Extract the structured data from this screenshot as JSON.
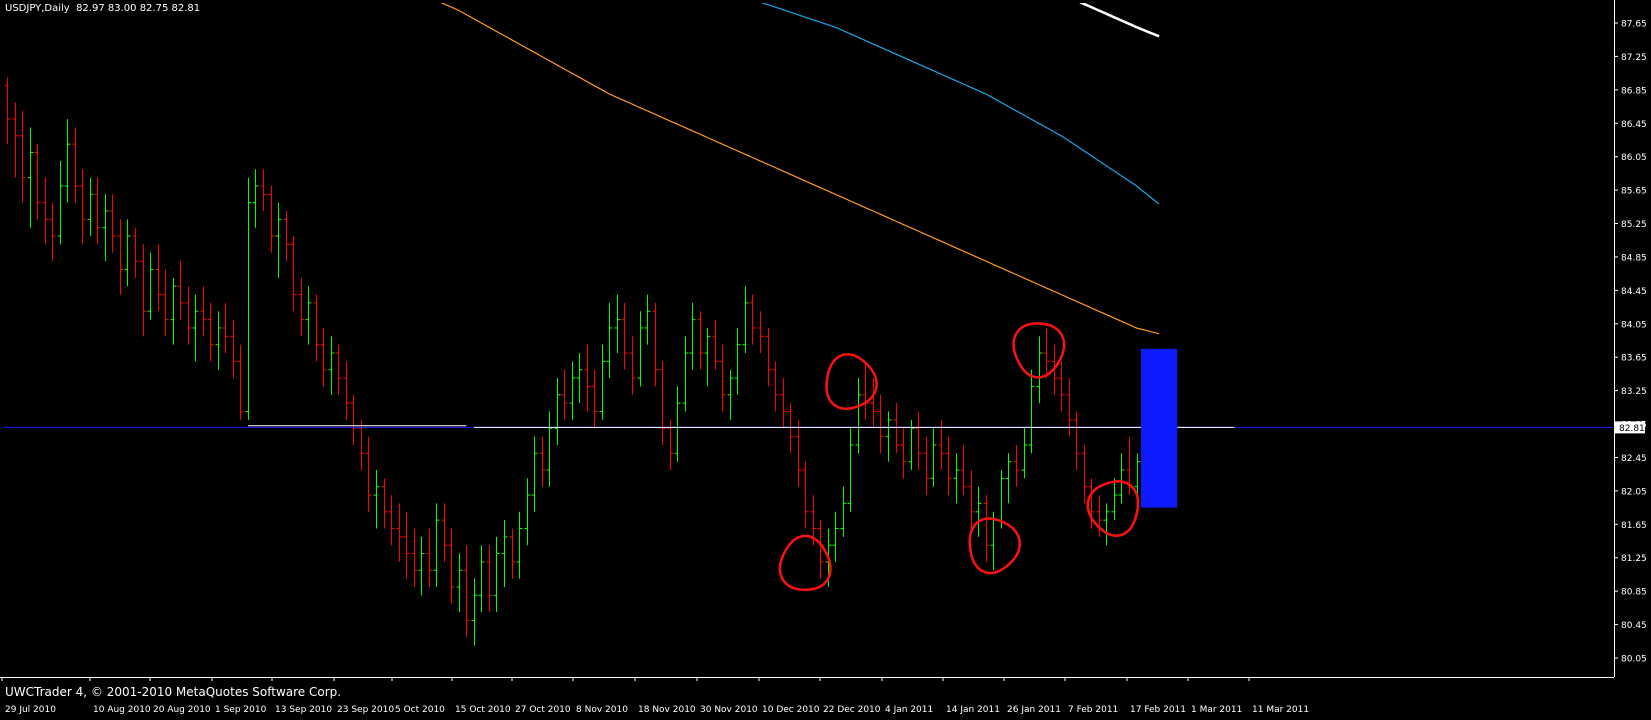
{
  "window": {
    "title": "USDJPY,Daily  82.97 83.00 82.75 82.81",
    "copyright": "UWCTrader 4, © 2001-2010 MetaQuotes Software Corp."
  },
  "colors": {
    "background": "#000000",
    "axis": "#ffffff",
    "bull_bar": "#00ff00",
    "bear_bar": "#ff0000",
    "ma_fast": "#ff9a20",
    "ma_mid": "#18a8e8",
    "ma_slow": "#ffffff",
    "bid_line": "#1a1aff",
    "support_line": "#ffffff",
    "highlight_box": "#0f1bff",
    "annotation": "#ff1010"
  },
  "chart_data": {
    "type": "ohlc",
    "symbol": "USDJPY",
    "timeframe": "Daily",
    "current": {
      "open": 82.97,
      "high": 83.0,
      "low": 82.75,
      "close": 82.81,
      "label": "82.81"
    },
    "ylim": [
      80.05,
      87.65
    ],
    "y_ticks": [
      "87.65",
      "87.25",
      "86.85",
      "86.45",
      "86.05",
      "85.65",
      "85.25",
      "84.85",
      "84.45",
      "84.05",
      "83.65",
      "83.25",
      "82.85",
      "82.45",
      "82.05",
      "81.65",
      "81.25",
      "80.85",
      "80.45",
      "80.05"
    ],
    "x_ticks": [
      "29 Jul 2010",
      "10 Aug 2010",
      "20 Aug 2010",
      "1 Sep 2010",
      "13 Sep 2010",
      "23 Sep 2010",
      "5 Oct 2010",
      "15 Oct 2010",
      "27 Oct 2010",
      "8 Nov 2010",
      "18 Nov 2010",
      "30 Nov 2010",
      "10 Dec 2010",
      "22 Dec 2010",
      "4 Jan 2011",
      "14 Jan 2011",
      "26 Jan 2011",
      "7 Feb 2011",
      "17 Feb 2011",
      "1 Mar 2011",
      "11 Mar 2011"
    ],
    "bar_count": 162,
    "bars": [
      [
        86.9,
        87.0,
        86.2,
        86.5
      ],
      [
        86.5,
        86.7,
        85.8,
        86.3
      ],
      [
        86.3,
        86.6,
        85.5,
        85.8
      ],
      [
        85.8,
        86.4,
        85.2,
        86.1
      ],
      [
        86.1,
        86.2,
        85.3,
        85.5
      ],
      [
        85.5,
        85.8,
        85.0,
        85.3
      ],
      [
        85.3,
        85.5,
        84.8,
        85.1
      ],
      [
        85.1,
        86.0,
        85.0,
        85.7
      ],
      [
        85.7,
        86.5,
        85.5,
        86.2
      ],
      [
        86.2,
        86.4,
        85.5,
        85.7
      ],
      [
        85.7,
        85.9,
        85.0,
        85.3
      ],
      [
        85.3,
        85.8,
        85.1,
        85.6
      ],
      [
        85.6,
        85.8,
        85.0,
        85.2
      ],
      [
        85.2,
        85.6,
        84.8,
        85.4
      ],
      [
        85.4,
        85.6,
        84.9,
        85.1
      ],
      [
        85.1,
        85.3,
        84.4,
        84.7
      ],
      [
        84.7,
        85.3,
        84.5,
        85.1
      ],
      [
        85.1,
        85.2,
        84.6,
        84.8
      ],
      [
        84.8,
        85.0,
        83.9,
        84.2
      ],
      [
        84.2,
        84.9,
        84.1,
        84.7
      ],
      [
        84.7,
        85.0,
        84.2,
        84.4
      ],
      [
        84.4,
        84.7,
        83.9,
        84.1
      ],
      [
        84.1,
        84.6,
        83.8,
        84.5
      ],
      [
        84.5,
        84.8,
        84.1,
        84.3
      ],
      [
        84.3,
        84.5,
        83.8,
        84.0
      ],
      [
        84.0,
        84.4,
        83.6,
        84.2
      ],
      [
        84.2,
        84.5,
        83.9,
        84.1
      ],
      [
        84.1,
        84.3,
        83.6,
        83.8
      ],
      [
        83.8,
        84.2,
        83.5,
        84.0
      ],
      [
        84.0,
        84.3,
        83.7,
        83.9
      ],
      [
        83.9,
        84.1,
        83.4,
        83.6
      ],
      [
        83.6,
        83.8,
        82.9,
        83.0
      ],
      [
        83.0,
        85.8,
        82.9,
        85.5
      ],
      [
        85.5,
        85.9,
        85.2,
        85.7
      ],
      [
        85.7,
        85.9,
        85.4,
        85.6
      ],
      [
        85.6,
        85.7,
        84.9,
        85.1
      ],
      [
        85.1,
        85.5,
        84.6,
        85.3
      ],
      [
        85.3,
        85.4,
        84.8,
        85.0
      ],
      [
        85.0,
        85.1,
        84.2,
        84.4
      ],
      [
        84.4,
        84.6,
        83.9,
        84.1
      ],
      [
        84.1,
        84.5,
        83.8,
        84.3
      ],
      [
        84.3,
        84.4,
        83.6,
        83.8
      ],
      [
        83.8,
        84.0,
        83.3,
        83.5
      ],
      [
        83.5,
        83.9,
        83.2,
        83.7
      ],
      [
        83.7,
        83.8,
        83.2,
        83.4
      ],
      [
        83.4,
        83.6,
        82.9,
        83.1
      ],
      [
        83.1,
        83.2,
        82.6,
        82.8
      ],
      [
        82.8,
        82.9,
        82.3,
        82.5
      ],
      [
        82.5,
        82.7,
        81.8,
        82.0
      ],
      [
        82.0,
        82.3,
        81.6,
        82.1
      ],
      [
        82.1,
        82.2,
        81.6,
        81.8
      ],
      [
        81.8,
        82.0,
        81.4,
        81.6
      ],
      [
        81.6,
        81.9,
        81.2,
        81.5
      ],
      [
        81.5,
        81.8,
        81.0,
        81.3
      ],
      [
        81.3,
        81.6,
        80.9,
        81.1
      ],
      [
        81.1,
        81.5,
        80.8,
        81.3
      ],
      [
        81.3,
        81.6,
        80.9,
        81.1
      ],
      [
        81.1,
        81.9,
        80.9,
        81.7
      ],
      [
        81.7,
        81.9,
        81.2,
        81.4
      ],
      [
        81.4,
        81.6,
        80.7,
        80.9
      ],
      [
        80.9,
        81.3,
        80.6,
        81.1
      ],
      [
        81.1,
        81.4,
        80.3,
        80.5
      ],
      [
        80.5,
        81.0,
        80.2,
        80.8
      ],
      [
        80.8,
        81.4,
        80.6,
        81.2
      ],
      [
        81.2,
        81.4,
        80.6,
        80.8
      ],
      [
        80.8,
        81.5,
        80.6,
        81.3
      ],
      [
        81.3,
        81.7,
        80.9,
        81.5
      ],
      [
        81.5,
        81.6,
        81.0,
        81.2
      ],
      [
        81.2,
        81.8,
        81.0,
        81.6
      ],
      [
        81.6,
        82.2,
        81.4,
        82.0
      ],
      [
        82.0,
        82.7,
        81.8,
        82.5
      ],
      [
        82.5,
        82.7,
        82.1,
        82.3
      ],
      [
        82.3,
        83.0,
        82.1,
        82.8
      ],
      [
        82.8,
        83.4,
        82.6,
        83.2
      ],
      [
        83.2,
        83.5,
        82.9,
        83.1
      ],
      [
        83.1,
        83.6,
        82.9,
        83.4
      ],
      [
        83.4,
        83.7,
        83.1,
        83.5
      ],
      [
        83.5,
        83.8,
        83.0,
        83.3
      ],
      [
        83.3,
        83.5,
        82.8,
        83.0
      ],
      [
        83.0,
        83.8,
        82.9,
        83.6
      ],
      [
        83.6,
        84.3,
        83.4,
        84.0
      ],
      [
        84.0,
        84.4,
        83.7,
        84.1
      ],
      [
        84.1,
        84.3,
        83.5,
        83.7
      ],
      [
        83.7,
        83.9,
        83.2,
        83.4
      ],
      [
        83.4,
        84.2,
        83.3,
        84.0
      ],
      [
        84.0,
        84.4,
        83.8,
        84.2
      ],
      [
        84.2,
        84.3,
        83.3,
        83.5
      ],
      [
        83.5,
        83.6,
        82.6,
        82.8
      ],
      [
        82.8,
        82.9,
        82.3,
        82.5
      ],
      [
        82.5,
        83.3,
        82.4,
        83.1
      ],
      [
        83.1,
        83.9,
        83.0,
        83.7
      ],
      [
        83.7,
        84.3,
        83.5,
        84.1
      ],
      [
        84.1,
        84.2,
        83.5,
        83.7
      ],
      [
        83.7,
        84.0,
        83.3,
        83.9
      ],
      [
        83.9,
        84.1,
        83.5,
        83.6
      ],
      [
        83.6,
        83.8,
        83.0,
        83.2
      ],
      [
        83.2,
        83.5,
        82.9,
        83.4
      ],
      [
        83.4,
        84.0,
        83.2,
        83.8
      ],
      [
        83.8,
        84.5,
        83.7,
        84.3
      ],
      [
        84.3,
        84.4,
        83.8,
        84.0
      ],
      [
        84.0,
        84.2,
        83.7,
        83.9
      ],
      [
        83.9,
        84.0,
        83.3,
        83.5
      ],
      [
        83.5,
        83.6,
        83.0,
        83.2
      ],
      [
        83.2,
        83.4,
        82.8,
        83.0
      ],
      [
        83.0,
        83.1,
        82.5,
        82.7
      ],
      [
        82.7,
        82.9,
        82.1,
        82.3
      ],
      [
        82.3,
        82.4,
        81.6,
        81.8
      ],
      [
        81.8,
        82.0,
        81.4,
        81.6
      ],
      [
        81.6,
        81.7,
        81.0,
        81.2
      ],
      [
        81.2,
        81.6,
        80.9,
        81.4
      ],
      [
        81.4,
        81.8,
        81.2,
        81.6
      ],
      [
        81.6,
        82.1,
        81.5,
        81.9
      ],
      [
        81.9,
        82.8,
        81.8,
        82.6
      ],
      [
        82.6,
        83.4,
        82.5,
        83.2
      ],
      [
        83.2,
        83.6,
        82.9,
        83.1
      ],
      [
        83.1,
        83.4,
        82.8,
        83.0
      ],
      [
        83.0,
        83.2,
        82.5,
        82.7
      ],
      [
        82.7,
        83.0,
        82.4,
        82.9
      ],
      [
        82.9,
        83.1,
        82.5,
        82.6
      ],
      [
        82.6,
        82.8,
        82.2,
        82.4
      ],
      [
        82.4,
        82.9,
        82.3,
        82.8
      ],
      [
        82.8,
        83.0,
        82.3,
        82.5
      ],
      [
        82.5,
        82.7,
        82.0,
        82.2
      ],
      [
        82.2,
        82.8,
        82.1,
        82.6
      ],
      [
        82.6,
        82.9,
        82.3,
        82.5
      ],
      [
        82.5,
        82.7,
        82.0,
        82.2
      ],
      [
        82.2,
        82.5,
        81.9,
        82.3
      ],
      [
        82.3,
        82.6,
        82.0,
        82.1
      ],
      [
        82.1,
        82.3,
        81.6,
        81.8
      ],
      [
        81.8,
        82.1,
        81.5,
        81.9
      ],
      [
        81.9,
        82.0,
        81.2,
        81.4
      ],
      [
        81.4,
        81.8,
        81.1,
        81.7
      ],
      [
        81.7,
        82.3,
        81.6,
        82.2
      ],
      [
        82.2,
        82.5,
        81.9,
        82.4
      ],
      [
        82.4,
        82.6,
        82.1,
        82.3
      ],
      [
        82.3,
        82.8,
        82.2,
        82.6
      ],
      [
        82.6,
        83.5,
        82.5,
        83.3
      ],
      [
        83.3,
        83.9,
        83.1,
        83.7
      ],
      [
        83.7,
        84.0,
        83.4,
        83.6
      ],
      [
        83.6,
        83.8,
        83.2,
        83.4
      ],
      [
        83.4,
        83.6,
        83.0,
        83.2
      ],
      [
        83.2,
        83.4,
        82.7,
        82.9
      ],
      [
        82.9,
        83.0,
        82.3,
        82.5
      ],
      [
        82.5,
        82.6,
        81.9,
        82.1
      ],
      [
        82.1,
        82.2,
        81.6,
        81.8
      ],
      [
        81.8,
        82.0,
        81.5,
        81.7
      ],
      [
        81.7,
        81.9,
        81.4,
        81.8
      ],
      [
        81.8,
        82.2,
        81.7,
        82.0
      ],
      [
        82.0,
        82.5,
        81.9,
        82.3
      ],
      [
        82.3,
        82.7,
        82.0,
        82.1
      ],
      [
        82.1,
        82.5,
        81.9,
        82.4
      ],
      [
        82.4,
        82.9,
        82.3,
        82.8
      ],
      [
        82.8,
        83.1,
        82.6,
        82.97
      ],
      [
        82.97,
        83.0,
        82.75,
        82.81
      ]
    ],
    "ma_fast": {
      "x": [
        0,
        30,
        60,
        80,
        100,
        120,
        130,
        140,
        150,
        161
      ],
      "y": [
        89.5,
        89.0,
        87.8,
        86.8,
        86.0,
        85.2,
        84.8,
        84.4,
        84.0,
        83.75
      ]
    },
    "ma_mid": {
      "x": [
        0,
        40,
        70,
        90,
        110,
        130,
        140,
        150,
        161
      ],
      "y": [
        90.8,
        90.0,
        89.0,
        88.2,
        87.6,
        86.8,
        86.3,
        85.7,
        84.9
      ]
    },
    "ma_slow": {
      "x": [
        100,
        110,
        120,
        130,
        140,
        150,
        161
      ],
      "y": [
        89.2,
        88.9,
        88.6,
        88.3,
        88.0,
        87.6,
        87.2
      ]
    },
    "ma_slow_drawn_from": 131,
    "bid_level": 82.81,
    "support_segments": [
      {
        "from": 32,
        "to": 61,
        "level": 82.83
      },
      {
        "from": 62,
        "to": 163,
        "level": 82.81
      }
    ],
    "highlight_zone": {
      "from": 151,
      "to": 155,
      "high": 83.75,
      "low": 81.85
    },
    "annotations": [
      {
        "type": "circle",
        "at_bar": 106,
        "price": 81.17
      },
      {
        "type": "circle",
        "at_bar": 112,
        "price": 83.35
      },
      {
        "type": "circle",
        "at_bar": 131,
        "price": 81.4
      },
      {
        "type": "circle",
        "at_bar": 137,
        "price": 83.75
      },
      {
        "type": "circle",
        "at_bar": 147,
        "price": 81.85
      }
    ]
  }
}
